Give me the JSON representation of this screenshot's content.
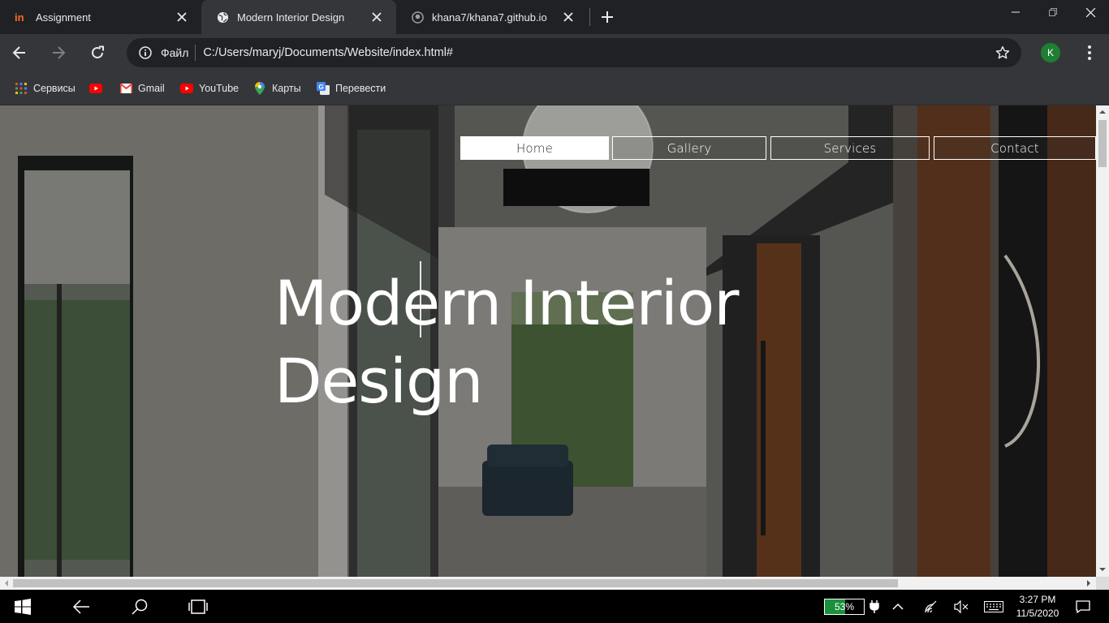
{
  "browser": {
    "tabs": [
      {
        "title": "Assignment",
        "favicon": "invision-icon"
      },
      {
        "title": "Modern Interior Design",
        "favicon": "globe-icon",
        "active": true
      },
      {
        "title": "khana7/khana7.github.io",
        "favicon": "github-icon"
      }
    ],
    "address": {
      "scheme_label": "Файл",
      "url": "C:/Users/maryj/Documents/Website/index.html#"
    },
    "profile_initial": "K",
    "bookmarks": [
      {
        "label": "Сервисы",
        "icon": "apps-grid-icon"
      },
      {
        "label": "",
        "icon": "youtube-icon"
      },
      {
        "label": "Gmail",
        "icon": "gmail-icon"
      },
      {
        "label": "YouTube",
        "icon": "youtube-icon"
      },
      {
        "label": "Карты",
        "icon": "maps-pin-icon"
      },
      {
        "label": "Перевести",
        "icon": "translate-icon"
      }
    ]
  },
  "page": {
    "nav": [
      {
        "label": "Home",
        "active": true
      },
      {
        "label": "Gallery"
      },
      {
        "label": "Services"
      },
      {
        "label": "Contact"
      }
    ],
    "hero": {
      "line1": "Modern Interior",
      "line2": "Design"
    }
  },
  "taskbar": {
    "battery_percent": "53%",
    "battery_level": 0.53,
    "time": "3:27 PM",
    "date": "11/5/2020"
  },
  "colors": {
    "tabstrip": "#202124",
    "toolbar": "#35363a",
    "battery_fill": "#1c8f3c",
    "profile": "#1e7e34"
  }
}
